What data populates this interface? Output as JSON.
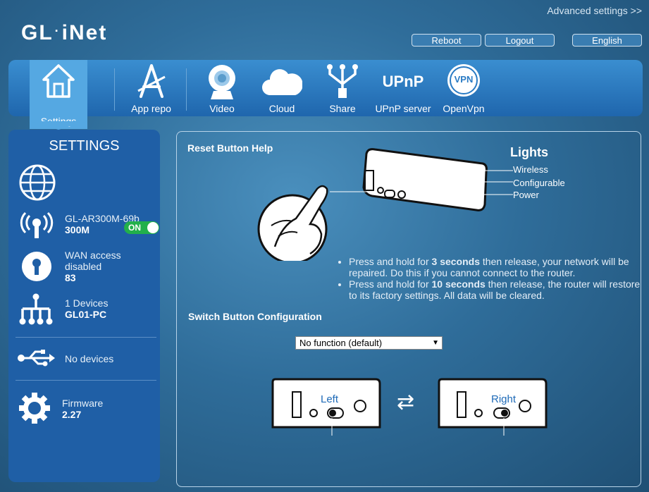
{
  "header": {
    "logo_text_left": "GL",
    "logo_dot": "·",
    "logo_text_right": "iNet",
    "advanced_link": "Advanced settings >>",
    "buttons": {
      "reboot": "Reboot",
      "logout": "Logout",
      "language": "English"
    }
  },
  "nav": {
    "items": [
      {
        "label": "Settings",
        "icon": "home-icon",
        "active": true
      },
      {
        "label": "App repo",
        "icon": "app-store-icon"
      },
      {
        "label": "Video",
        "icon": "webcam-icon"
      },
      {
        "label": "Cloud",
        "icon": "cloud-icon"
      },
      {
        "label": "Share",
        "icon": "usb-share-icon"
      },
      {
        "label": "UPnP server",
        "icon": "upnp-icon",
        "icon_text": "UPnP"
      },
      {
        "label": "OpenVpn",
        "icon": "vpn-icon",
        "icon_text": "VPN"
      }
    ]
  },
  "sidebar": {
    "title": "SETTINGS",
    "wifi": {
      "ssid": "GL-AR300M-69b",
      "speed": "300M",
      "toggle": "ON"
    },
    "wan": {
      "line1": "WAN access",
      "line2": "disabled",
      "value": "83"
    },
    "devices": {
      "count": "1 Devices",
      "name": "GL01-PC"
    },
    "usb": {
      "text": "No devices"
    },
    "firmware": {
      "label": "Firmware",
      "version": "2.27"
    }
  },
  "main": {
    "reset_title": "Reset Button Help",
    "lights": {
      "title": "Lights",
      "labels": [
        "Wireless",
        "Configurable",
        "Power"
      ]
    },
    "bullet1": {
      "pre": "Press and hold for ",
      "bold": "3 seconds",
      "post": " then release, your network will be repaired. Do this if you cannot connect to the router."
    },
    "bullet2": {
      "pre": "Press and hold for ",
      "bold": "10 seconds",
      "post": " then release, the router will restore to its factory settings. All data will be cleared."
    },
    "switch_title": "Switch Button Configuration",
    "switch_select": "No function (default)",
    "switch_left": "Left",
    "switch_right": "Right",
    "switch_arrows": "⇄"
  },
  "colors": {
    "nav_bg": "#2a7bc4",
    "nav_active": "#55a8e2",
    "sidebar_bg": "#1f5fa6",
    "toggle_on": "#22b04b"
  }
}
